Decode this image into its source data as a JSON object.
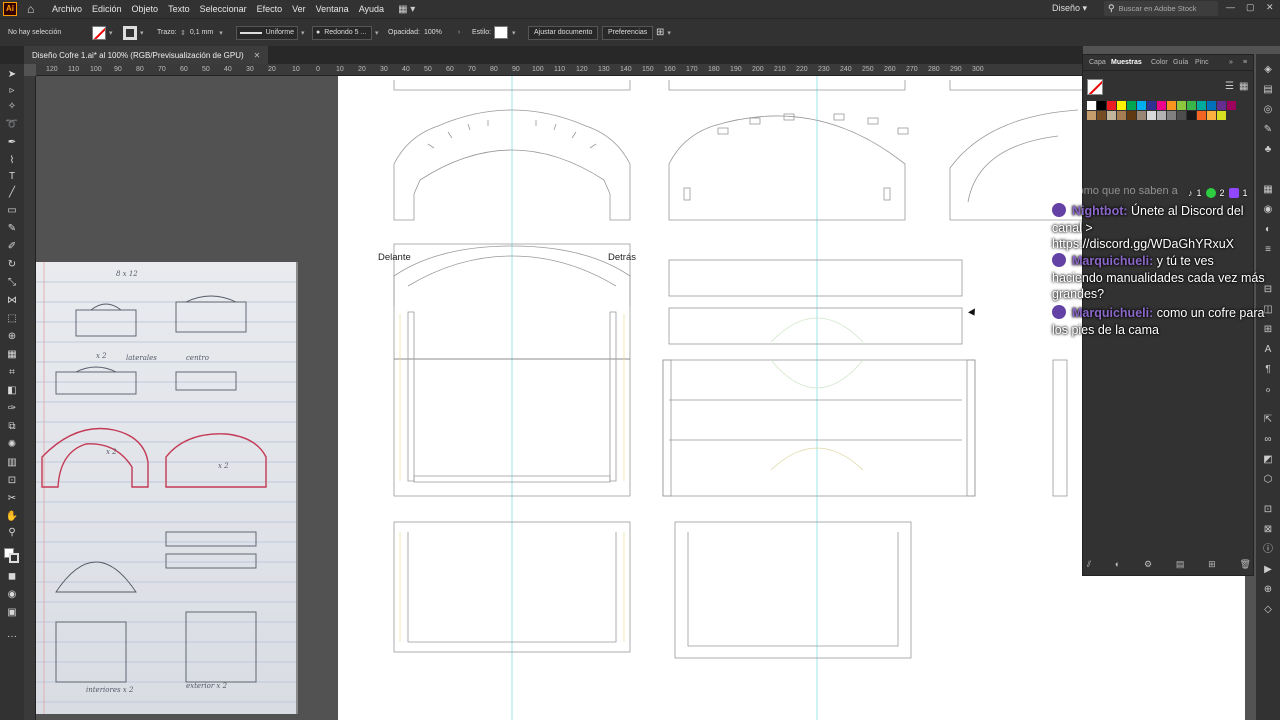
{
  "app": {
    "logo_text": "Ai",
    "menus": [
      "Archivo",
      "Edición",
      "Objeto",
      "Texto",
      "Seleccionar",
      "Efecto",
      "Ver",
      "Ventana",
      "Ayuda"
    ],
    "workspace": "Diseño",
    "search_placeholder": "Buscar en Adobe Stock"
  },
  "control_bar": {
    "selection_status": "No hay selección",
    "stroke_label": "Trazo:",
    "stroke_value": "0,1 mm",
    "profile_value": "Uniforme",
    "brush_value": "Redondo 5 ...",
    "opacity_label": "Opacidad:",
    "opacity_value": "100%",
    "style_label": "Estilo:",
    "fit_document_button": "Ajustar documento",
    "preferences_button": "Preferencias"
  },
  "document_tab": {
    "title": "Diseño Cofre 1.ai* al 100% (RGB/Previsualización de GPU)"
  },
  "ruler_ticks": [
    "120",
    "110",
    "100",
    "90",
    "80",
    "70",
    "60",
    "50",
    "40",
    "30",
    "20",
    "10",
    "0",
    "10",
    "20",
    "30",
    "40",
    "50",
    "60",
    "70",
    "80",
    "90",
    "100",
    "110",
    "120",
    "130",
    "140",
    "150",
    "160",
    "170",
    "180",
    "190",
    "200",
    "210",
    "220",
    "230",
    "240",
    "250",
    "260",
    "270",
    "280",
    "290",
    "300"
  ],
  "artboard_labels": {
    "front": "Delante",
    "back": "Detrás"
  },
  "swatches_panel": {
    "tabs": [
      "Capa",
      "Muestras",
      "Color",
      "Guía",
      "Pinc"
    ],
    "active_tab": "Muestras",
    "swatch_colors": [
      "#ffffff",
      "#000000",
      "#ed1c24",
      "#fff200",
      "#00a651",
      "#00aeef",
      "#2e3192",
      "#ec008c",
      "#f7941d",
      "#8dc63f",
      "#39b54a",
      "#00a99d",
      "#0072bc",
      "#662d91",
      "#9e005d",
      "#c69c6d",
      "#754c24",
      "#c2b59b",
      "#a67c52",
      "#603913",
      "#998675",
      "#d9d9d9",
      "#b3b3b3",
      "#808080",
      "#4d4d4d",
      "#1a1a1a",
      "#f26522",
      "#fbb040",
      "#d7df23"
    ]
  },
  "stream_overlay": {
    "counters": {
      "tiktok": "1",
      "xbox": "2",
      "twitch": "1"
    },
    "partial_line": "como que no saben a",
    "messages": [
      {
        "user": "Nightbot:",
        "text": "Únete al Discord del canal > https://discord.gg/WDaGhYRxuX"
      },
      {
        "user": "Marquichueli:",
        "text": "y tú te ves haciendo manualidades cada vez más grandes?"
      },
      {
        "user": "Marquichueli:",
        "text": "como un cofre para los pies de la cama"
      }
    ]
  },
  "sketch_notes": [
    "8 x 12",
    "x 2",
    "laterales",
    "centro",
    "x 2",
    "x 2",
    "interiores x 2",
    "exterior x 2"
  ]
}
